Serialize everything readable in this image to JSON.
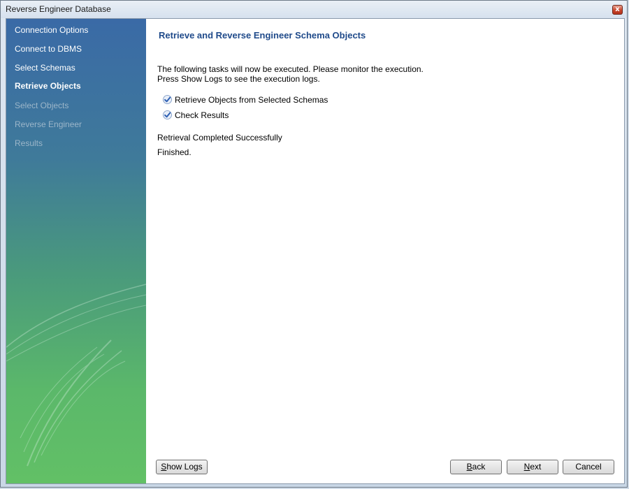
{
  "window": {
    "title": "Reverse Engineer Database",
    "close_glyph": "x"
  },
  "sidebar": {
    "steps": [
      {
        "label": "Connection Options",
        "state": "done"
      },
      {
        "label": "Connect to DBMS",
        "state": "done"
      },
      {
        "label": "Select Schemas",
        "state": "done"
      },
      {
        "label": "Retrieve Objects",
        "state": "current"
      },
      {
        "label": "Select Objects",
        "state": "pending"
      },
      {
        "label": "Reverse Engineer",
        "state": "pending"
      },
      {
        "label": "Results",
        "state": "pending"
      }
    ]
  },
  "main": {
    "heading": "Retrieve and Reverse Engineer Schema Objects",
    "description_line1": "The following tasks will now be executed. Please monitor the execution.",
    "description_line2": "Press Show Logs to see the execution logs.",
    "tasks": [
      {
        "label": "Retrieve Objects from Selected Schemas",
        "status_icon": "check-icon"
      },
      {
        "label": "Check Results",
        "status_icon": "check-icon"
      }
    ],
    "status_message": "Retrieval Completed Successfully",
    "finished_message": "Finished."
  },
  "buttons": {
    "show_logs": {
      "label_underline": "S",
      "label_rest": "how Logs"
    },
    "back": {
      "label_underline": "B",
      "label_rest": "ack"
    },
    "next": {
      "label_underline": "N",
      "label_rest": "ext"
    },
    "cancel": {
      "label": "Cancel"
    }
  },
  "colors": {
    "heading": "#1f4a8a",
    "sidebar_top": "#3a6aa6",
    "sidebar_bottom": "#62c066",
    "check_blue": "#2c5fb3"
  }
}
